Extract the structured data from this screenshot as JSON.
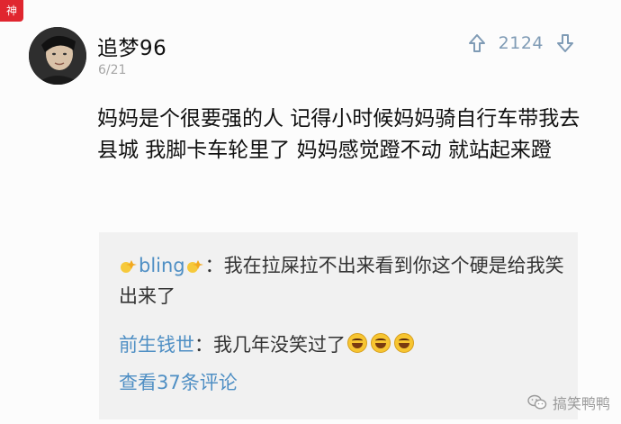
{
  "corner_tag": "神",
  "post": {
    "username": "追梦96",
    "date": "6/21",
    "vote_count": "2124",
    "body": "妈妈是个很要强的人 记得小时候妈妈骑自行车带我去县城 我脚卡车轮里了 妈妈感觉蹬不动 就站起来蹬"
  },
  "replies": [
    {
      "name": "bling",
      "separator": "：",
      "text": "我在拉屎拉不出来看到你这个硬是给我笑出来了"
    },
    {
      "name": "前生钱世",
      "separator": "：",
      "text": "我几年没笑过了"
    }
  ],
  "view_more": "查看37条评论",
  "watermark": "搞笑鸭鸭",
  "icons": {
    "upvote": "up-arrow-icon",
    "downvote": "down-arrow-icon",
    "sparkle": "sparkle-icon",
    "laugh": "laughing-emoji-icon",
    "wechat": "wechat-icon"
  },
  "colors": {
    "accent": "#4f8fc4",
    "vote": "#7f9bb5",
    "tag": "#e0262f"
  }
}
